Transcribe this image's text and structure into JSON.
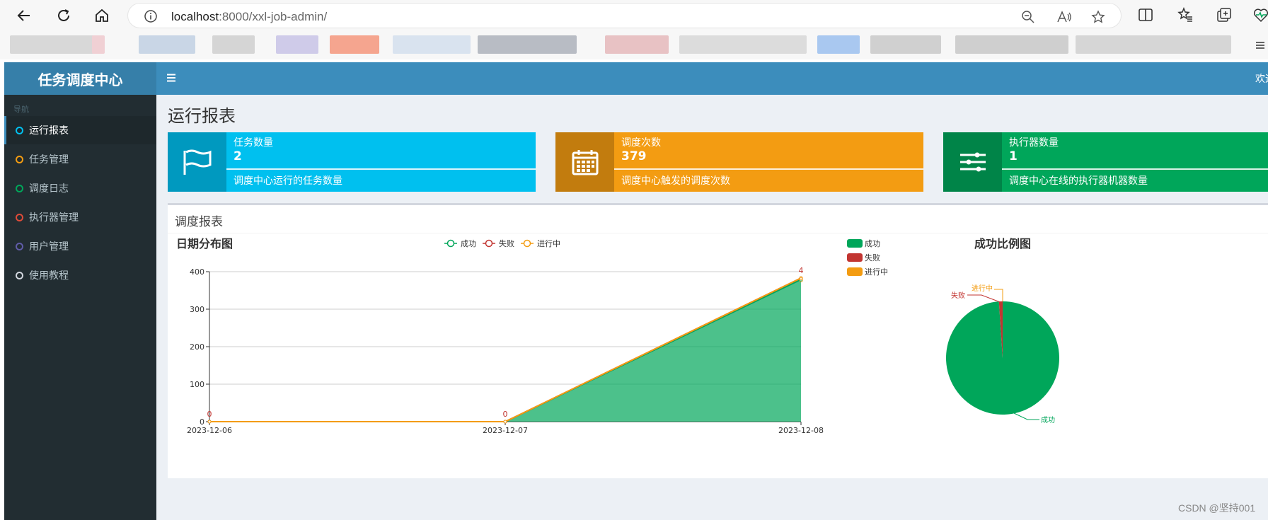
{
  "browser": {
    "url": "localhost:8000/xxl-job-admin/",
    "url_host": "localhost",
    "url_rest": ":8000/xxl-job-admin/"
  },
  "app": {
    "logo": "任务调度中心",
    "welcome": "欢迎",
    "sidebar_header": "导航",
    "sidebar": [
      {
        "label": "运行报表",
        "color": "#00c0ef",
        "active": true
      },
      {
        "label": "任务管理",
        "color": "#f39c12",
        "active": false
      },
      {
        "label": "调度日志",
        "color": "#00a65a",
        "active": false
      },
      {
        "label": "执行器管理",
        "color": "#dd4b39",
        "active": false
      },
      {
        "label": "用户管理",
        "color": "#605ca8",
        "active": false
      },
      {
        "label": "使用教程",
        "color": "#d2d6de",
        "active": false
      }
    ],
    "page_title": "运行报表",
    "info_boxes": [
      {
        "title": "任务数量",
        "number": "2",
        "desc": "调度中心运行的任务数量",
        "bg": "#00c0ef",
        "icon": "flag-icon"
      },
      {
        "title": "调度次数",
        "number": "379",
        "desc": "调度中心触发的调度次数",
        "bg": "#f39c12",
        "icon": "calendar-icon"
      },
      {
        "title": "执行器数量",
        "number": "1",
        "desc": "调度中心在线的执行器机器数量",
        "bg": "#00a65a",
        "icon": "sliders-icon"
      }
    ],
    "report_title": "调度报表",
    "watermark": "CSDN @坚持001"
  },
  "chart_data": [
    {
      "type": "area",
      "title": "日期分布图",
      "categories": [
        "2023-12-06",
        "2023-12-07",
        "2023-12-08"
      ],
      "series": [
        {
          "name": "成功",
          "values": [
            0,
            0,
            379
          ],
          "color": "#00a65a"
        },
        {
          "name": "失败",
          "values": [
            0,
            0,
            4
          ],
          "color": "#c23531"
        },
        {
          "name": "进行中",
          "values": [
            0,
            0,
            0
          ],
          "color": "#f39c12"
        }
      ],
      "data_labels": [
        "0",
        "0",
        "4"
      ],
      "top_label_extra": "0",
      "yticks": [
        "0",
        "100",
        "200",
        "300",
        "400"
      ],
      "ylim": [
        0,
        400
      ],
      "legend": "top-center"
    },
    {
      "type": "pie",
      "title": "成功比例图",
      "slices": [
        {
          "name": "成功",
          "value": 375,
          "color": "#00a65a"
        },
        {
          "name": "失败",
          "value": 4,
          "color": "#c23531"
        },
        {
          "name": "进行中",
          "value": 0,
          "color": "#f39c12"
        }
      ],
      "legend": "top-left"
    }
  ]
}
